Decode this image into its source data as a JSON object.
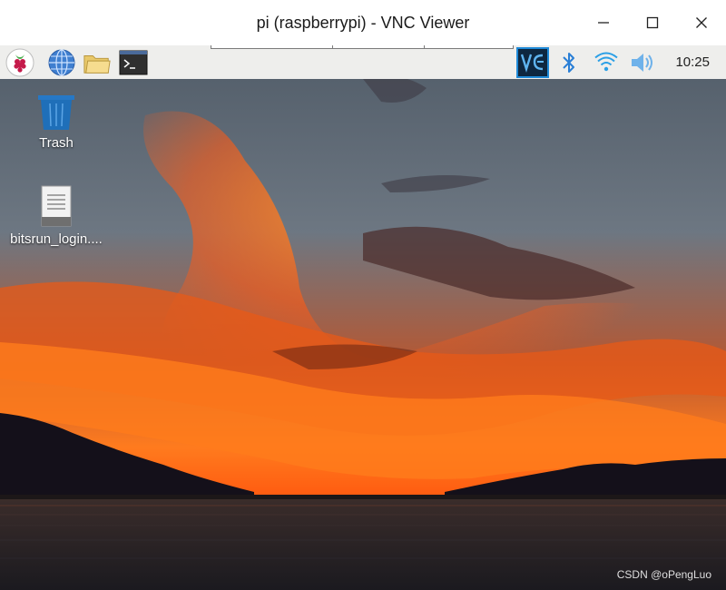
{
  "window": {
    "title": "pi (raspberrypi) - VNC Viewer",
    "controls": [
      "minimize-icon",
      "maximize-icon",
      "close-icon"
    ]
  },
  "taskbar": {
    "launchers": [
      "raspberry-menu-icon",
      "web-browser-icon",
      "file-manager-icon",
      "terminal-icon"
    ],
    "tray": [
      "vnc-icon",
      "bluetooth-icon",
      "wifi-icon",
      "volume-icon"
    ],
    "clock": "10:25"
  },
  "desktop": {
    "icons": [
      {
        "label": "Trash",
        "icon": "trash-icon"
      },
      {
        "label": "bitsrun_login....",
        "icon": "file-icon"
      }
    ],
    "watermark": "CSDN @oPengLuo"
  },
  "colors": {
    "taskbar_bg": "#eeeeec",
    "vnc_accent": "#1f8ad8",
    "tray_blue": "#2a7fd6"
  }
}
